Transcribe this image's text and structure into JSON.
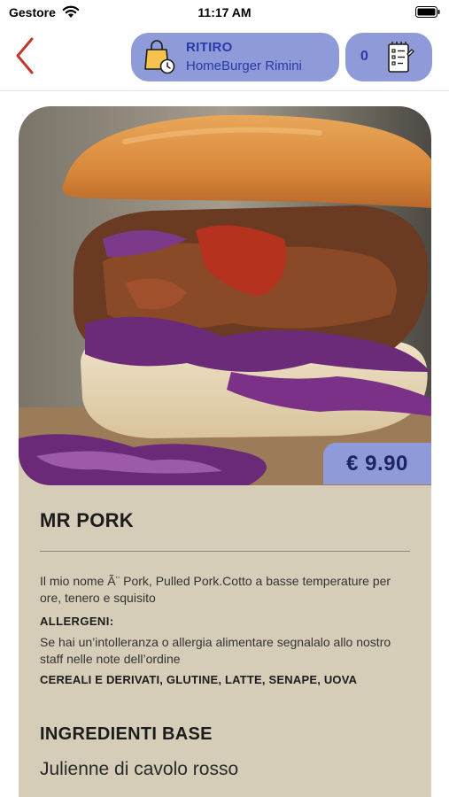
{
  "status_bar": {
    "carrier": "Gestore",
    "time": "11:17 AM"
  },
  "header": {
    "pickup": {
      "mode": "RITIRO",
      "store": "HomeBurger Rimini"
    },
    "cart": {
      "count": "0"
    }
  },
  "product": {
    "price": "€ 9.90",
    "name": "MR PORK",
    "description": "Il mio nome Ã¨ Pork, Pulled Pork.Cotto a basse temperature per ore, tenero e squisito",
    "allergens_title": "ALLERGENI:",
    "allergens_note": "Se hai un’intolleranza o allergia alimentare segnalalo allo nostro staff nelle note dell’ordine",
    "allergens_list": "CEREALI E DERIVATI, GLUTINE, LATTE, SENAPE, UOVA",
    "ingredients_title": "INGREDIENTI BASE",
    "ingredients": [
      "Julienne di cavolo rosso"
    ]
  },
  "colors": {
    "accent": "#8f9bd8",
    "accent_text": "#2b3aa8",
    "card_background": "#d5cdb7",
    "back_arrow": "#c0392b"
  },
  "icons": {
    "back": "chevron-left-icon",
    "pickup": "shopping-bag-clock-icon",
    "order": "order-list-icon"
  }
}
